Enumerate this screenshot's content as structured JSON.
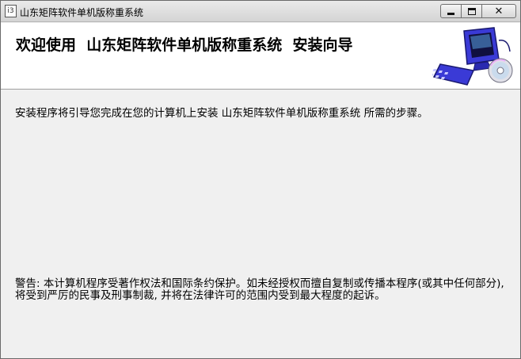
{
  "window": {
    "title": "山东矩阵软件单机版称重系统",
    "app_icon_glyph": "i3"
  },
  "caption_buttons": {
    "minimize_icon": "minimize-icon",
    "maximize_icon": "maximize-icon",
    "close_icon": "close-icon",
    "close_glyph": "✕"
  },
  "header": {
    "title": "欢迎使用  山东矩阵软件单机版称重系统  安装向导",
    "art_icon": "computer-with-cd-icon"
  },
  "content": {
    "intro": "安装程序将引导您完成在您的计算机上安装 山东矩阵软件单机版称重系统 所需的步骤。",
    "warning": "警告: 本计算机程序受著作权法和国际条约保护。如未经授权而擅自复制或传播本程序(或其中任何部分), 将受到严厉的民事及刑事制裁, 并将在法律许可的范围内受到最大程度的起诉。"
  },
  "colors": {
    "title_bar_top": "#eaeaea",
    "title_bar_bottom": "#d4d4d4",
    "dialog_background": "#f0f0f0",
    "header_background": "#ffffff",
    "monitor_blue": "#3a3ad6"
  }
}
